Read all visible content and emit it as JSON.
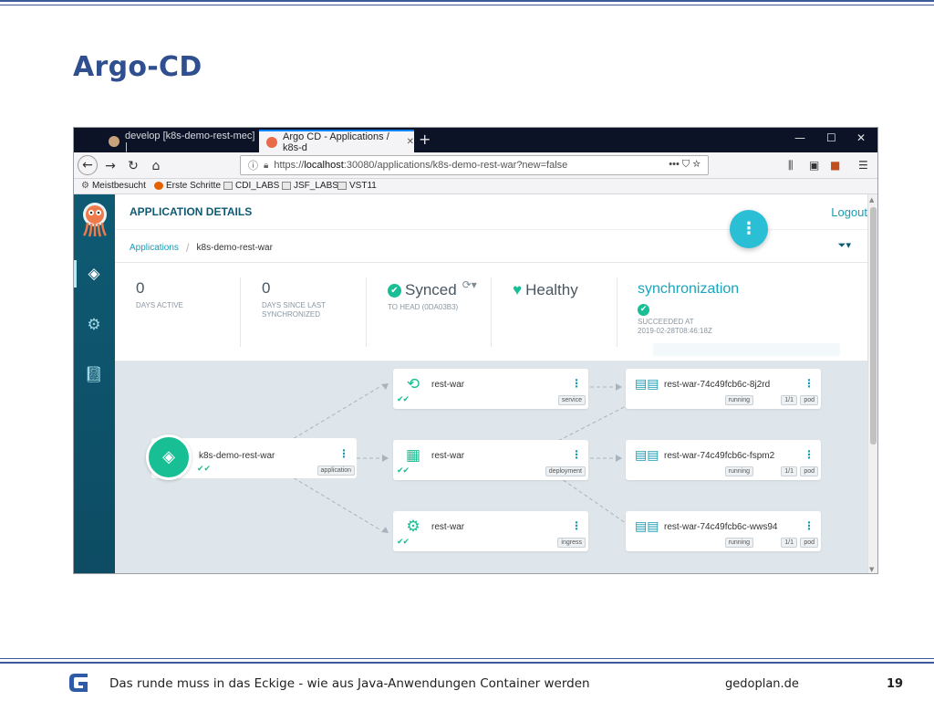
{
  "slide": {
    "title": "Argo-CD",
    "footer_text": "Das runde muss in das Eckige - wie aus Java-Anwendungen Container werden",
    "footer_site": "gedoplan.de",
    "page_number": "19",
    "accent_color": "#2f4f8f"
  },
  "browser": {
    "tabs": [
      {
        "label": "develop [k8s-demo-rest-mec] |"
      },
      {
        "label": "Argo CD - Applications / k8s-d"
      }
    ],
    "new_tab": "+",
    "window_controls": {
      "minimize": "—",
      "maximize": "☐",
      "close": "✕"
    },
    "url": {
      "prefix": "https://",
      "host": "localhost",
      "rest": ":30080/applications/k8s-demo-rest-war?new=false"
    },
    "url_actions": "•••  ⛉  ☆",
    "bookmarks": [
      "Meistbesucht",
      "Erste Schritte",
      "CDI_LABS",
      "JSF_LABS",
      "VST11"
    ]
  },
  "argo": {
    "header_title": "APPLICATION DETAILS",
    "logout": "Logout",
    "fab_label": "⋮",
    "breadcrumb": {
      "root": "Applications",
      "current": "k8s-demo-rest-war"
    },
    "stats": {
      "days_active": {
        "value": "0",
        "label": "DAYS ACTIVE"
      },
      "days_since_sync": {
        "value": "0",
        "label_1": "DAYS SINCE LAST",
        "label_2": "SYNCHRONIZED"
      },
      "sync": {
        "status": "Synced",
        "detail": "TO HEAD (0DA03B3)"
      },
      "health": {
        "status": "Healthy"
      },
      "operation": {
        "title": "synchronization",
        "status": "SUCCEEDED AT",
        "timestamp": "2019-02-28T08:46:18Z"
      }
    },
    "colors": {
      "primary": "#0e5a73",
      "healthy": "#18be94",
      "link": "#1a9bb5",
      "graph_bg": "#dee6eb"
    },
    "graph": {
      "root": {
        "name": "k8s-demo-rest-war",
        "tag": "application"
      },
      "resources": [
        {
          "name": "rest-war",
          "tag": "service",
          "icon": "service-icon"
        },
        {
          "name": "rest-war",
          "tag": "deployment",
          "icon": "deployment-icon"
        },
        {
          "name": "rest-war",
          "tag": "ingress",
          "icon": "ingress-icon"
        }
      ],
      "pods": [
        {
          "name": "rest-war-74c49fcb6c-8j2rd",
          "tags": [
            "running",
            "1/1",
            "pod"
          ]
        },
        {
          "name": "rest-war-74c49fcb6c-fspm2",
          "tags": [
            "running",
            "1/1",
            "pod"
          ]
        },
        {
          "name": "rest-war-74c49fcb6c-wws94",
          "tags": [
            "running",
            "1/1",
            "pod"
          ]
        }
      ]
    }
  }
}
